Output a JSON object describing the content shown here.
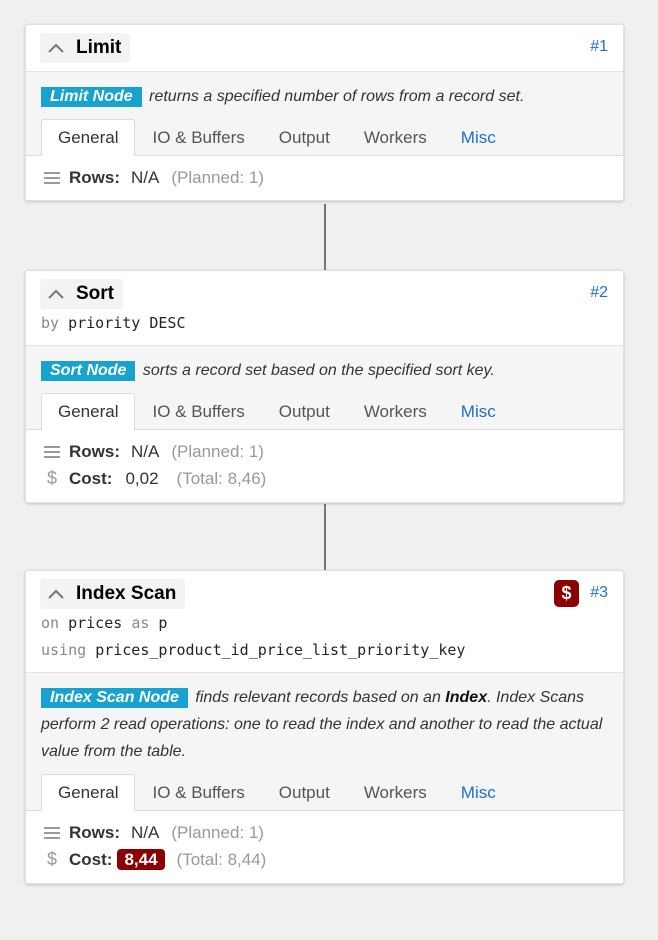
{
  "tabs": [
    "General",
    "IO & Buffers",
    "Output",
    "Workers",
    "Misc"
  ],
  "nodes": [
    {
      "title": "Limit",
      "id": "#1",
      "badge": "Limit Node",
      "description": " returns a specified number of rows from a record set.",
      "rows_label": "Rows:",
      "rows_value": "N/A",
      "rows_planned": "(Planned: 1)"
    },
    {
      "title": "Sort",
      "id": "#2",
      "sub_kw": "by",
      "sub_text": "priority DESC",
      "badge": "Sort Node",
      "description": " sorts a record set based on the specified sort key.",
      "rows_label": "Rows:",
      "rows_value": "N/A",
      "rows_planned": "(Planned: 1)",
      "cost_label": "Cost:",
      "cost_value": "0,02",
      "cost_total": "(Total: 8,46)"
    },
    {
      "title": "Index Scan",
      "id": "#3",
      "cost_flag": "$",
      "on_kw": "on",
      "on_table": "prices",
      "as_kw": "as",
      "alias": "p",
      "using_kw": "using",
      "index_name": "prices_product_id_price_list_priority_key",
      "badge": "Index Scan Node",
      "desc_part1": " finds relevant records based on an ",
      "desc_bold": "Index",
      "desc_part2": ". Index Scans perform 2 read operations: one to read the index and another to read the actual value from the table.",
      "rows_label": "Rows:",
      "rows_value": "N/A",
      "rows_planned": "(Planned: 1)",
      "cost_label": "Cost:",
      "cost_value": "8,44",
      "cost_total": "(Total: 8,44)"
    }
  ],
  "colors": {
    "accent_badge": "#17a2cf",
    "cost_alert": "#8b0000",
    "link": "#1f6fcf"
  }
}
